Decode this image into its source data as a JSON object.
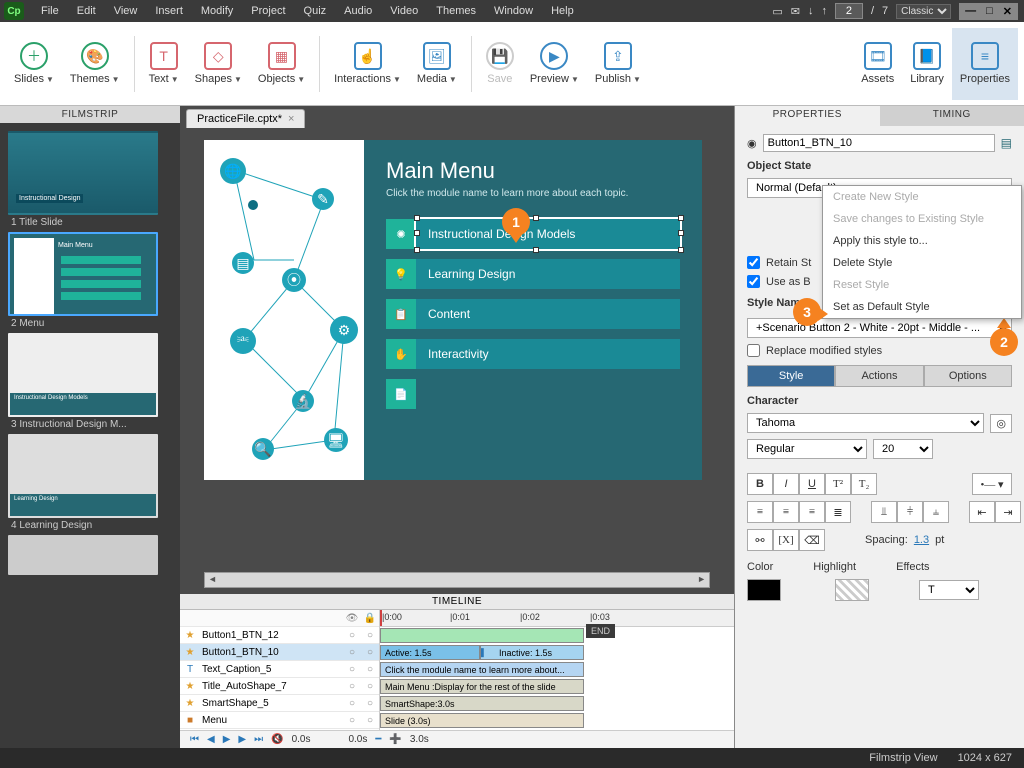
{
  "app": {
    "logo": "Cp"
  },
  "menubar": [
    "File",
    "Edit",
    "View",
    "Insert",
    "Modify",
    "Project",
    "Quiz",
    "Audio",
    "Video",
    "Themes",
    "Window",
    "Help"
  ],
  "paging": {
    "current": "2",
    "total": "7",
    "workspace": "Classic"
  },
  "ribbon": {
    "slides": "Slides",
    "themes": "Themes",
    "text": "Text",
    "shapes": "Shapes",
    "objects": "Objects",
    "interactions": "Interactions",
    "media": "Media",
    "save": "Save",
    "preview": "Preview",
    "publish": "Publish",
    "assets": "Assets",
    "library": "Library",
    "properties": "Properties"
  },
  "tab": {
    "name": "PracticeFile.cptx*"
  },
  "filmstrip": {
    "title": "FILMSTRIP",
    "thumbs": [
      {
        "cap": "1 Title Slide"
      },
      {
        "cap": "2 Menu"
      },
      {
        "cap": "3 Instructional Design M..."
      },
      {
        "cap": "4 Learning Design"
      }
    ]
  },
  "canvas": {
    "title": "Main Menu",
    "sub": "Click the module name to learn more about each topic.",
    "buttons": [
      {
        "label": "Instructional Design Models",
        "sel": true
      },
      {
        "label": "Learning Design"
      },
      {
        "label": "Content"
      },
      {
        "label": "Interactivity"
      },
      {
        "label": ""
      }
    ]
  },
  "callouts": {
    "c1": "1",
    "c2": "2",
    "c3": "3"
  },
  "timeline": {
    "title": "TIMELINE",
    "rows": [
      {
        "name": "Button1_BTN_12",
        "star": "★",
        "bar": ""
      },
      {
        "name": "Button1_BTN_10",
        "star": "★",
        "bar": "Active: 1.5s",
        "bar2": "Inactive: 1.5s",
        "sel": true
      },
      {
        "name": "Text_Caption_5",
        "star": "T",
        "bar": "Click the module name to learn more about..."
      },
      {
        "name": "Title_AutoShape_7",
        "star": "★",
        "bar": "Main Menu :Display for the rest of the slide"
      },
      {
        "name": "SmartShape_5",
        "star": "★",
        "bar": "SmartShape:3.0s"
      },
      {
        "name": "Menu",
        "star": "■",
        "bar": "Slide (3.0s)"
      }
    ],
    "ticks": [
      "|0:00",
      "|0:01",
      "|0:02",
      "|0:03"
    ],
    "end": "END",
    "footer": {
      "times": [
        "0.0s",
        "0.0s",
        "3.0s"
      ]
    }
  },
  "properties": {
    "tab_props": "PROPERTIES",
    "tab_timing": "TIMING",
    "obj_name": "Button1_BTN_10",
    "objstate_label": "Object State",
    "state": "Normal (Default)",
    "retain": "Retain St",
    "useas": "Use as B",
    "stylename_label": "Style Name",
    "stylename": "+Scenario Button 2 - White -  20pt - Middle - ...",
    "replace": "Replace modified styles",
    "tabs": {
      "style": "Style",
      "actions": "Actions",
      "options": "Options"
    },
    "character_label": "Character",
    "font": "Tahoma",
    "weight": "Regular",
    "size": "20",
    "spacing_label": "Spacing:",
    "spacing": "1.3",
    "pt": "pt",
    "color": "Color",
    "highlight": "Highlight",
    "effects": "Effects"
  },
  "ctxmenu": [
    {
      "label": "Create New Style",
      "dis": true
    },
    {
      "label": "Save changes to Existing Style",
      "dis": true
    },
    {
      "label": "Apply this style to..."
    },
    {
      "label": "Delete Style"
    },
    {
      "label": "Reset Style",
      "dis": true
    },
    {
      "label": "Set as Default Style"
    }
  ],
  "status": {
    "view": "Filmstrip View",
    "dims": "1024 x 627"
  }
}
